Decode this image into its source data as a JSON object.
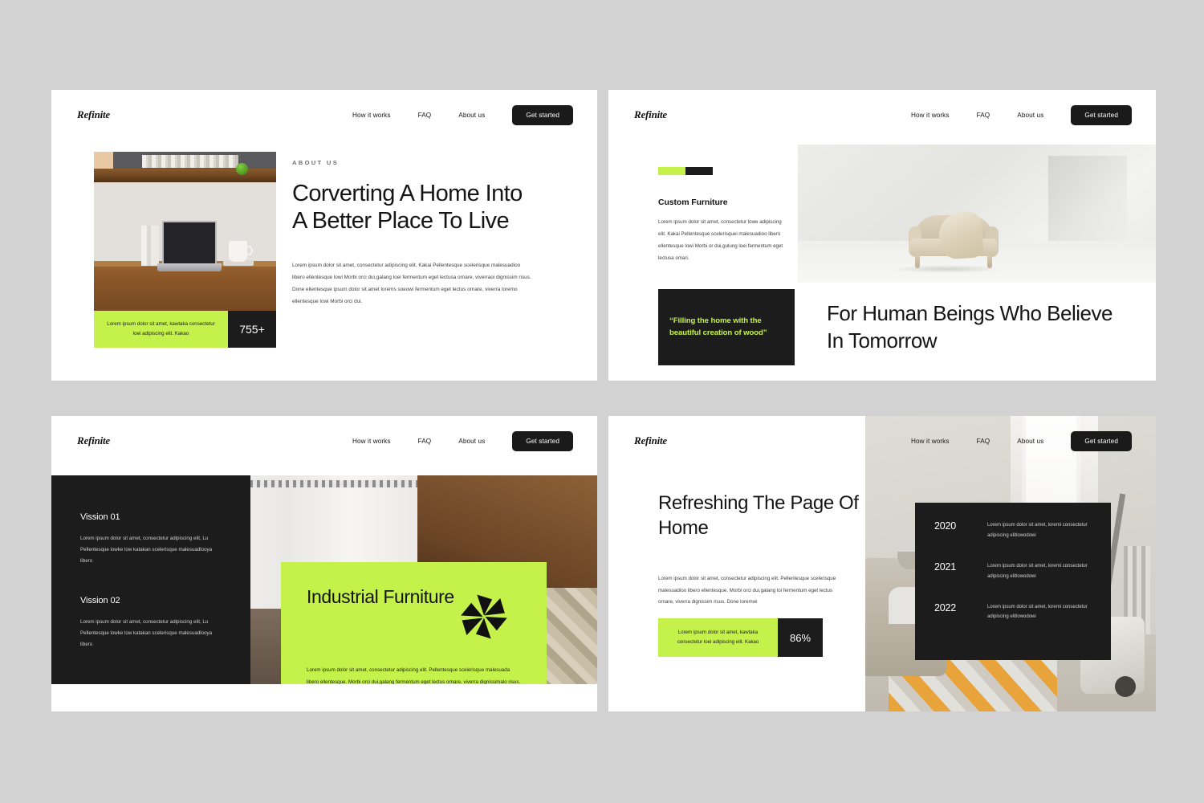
{
  "brand": {
    "logo": "Refinite",
    "accent_green": "#c4f24a",
    "dark": "#1c1c1c",
    "page_bg": "#d2d2d2"
  },
  "nav": {
    "links": [
      "How it works",
      "FAQ",
      "About us"
    ],
    "cta": "Get started"
  },
  "slide1": {
    "eyebrow": "ABOUT US",
    "heading": "Corverting A Home Into A Better Place To Live",
    "body": "Lorem ipsum dolor sit amet, consectetur adipiscing elit. Kakai Pellentesque scelerisque malesuadioo libero ellentesque lowi Morbi orci dui,galang loei fermentum eget lectusa ornare, viverraoi dignissim risus. Done ellentesque ipsum dolor sit amet lorems soeowi fermentum eget lectus ornare, viverra loremo ellentesque lowi Morbi orci dui.",
    "badge_text": "Lorem ipsum dolor sit amet, kawtaka consectetur loei adipiscing elit. Kakao",
    "badge_value": "755+",
    "photo_alt": "laptop-on-wooden-desk-photo"
  },
  "slide2": {
    "subheading": "Custom Furniture",
    "body": "Lorem ipsum dolor sit amet, consectetur lowe adipiscing elit. Kakai Pellentesque scelerisquei malesuadioo libero ellentesque lowi Morbi or dui,gulung loei fermentum eget lectusa omari.",
    "quote": "“Filling the home with the beautiful creation of wood”",
    "heading": "For Human Beings Who Believe In Tomorrow",
    "photo_alt": "cream-armchair-with-throw-photo"
  },
  "slide3": {
    "visions": [
      {
        "title": "Vission 01",
        "body": "Lorem ipsum dolor sit amet, consectetur adipiscing elit, Lu Pellentesque lowke low katakan scelerisque malesuadlooya libero"
      },
      {
        "title": "Vission 02",
        "body": "Lorem ipsum dolor sit amet, consectetur adipiscing elit, Lu Pellentesque lowke low katakan scelerisque malesuadlooya libero"
      }
    ],
    "card_heading": "Industrial Furniture",
    "card_body": "Lorem ipsum dolor sit amet, consectetur adipiscing elit. Pellentesque scelerisque malesuada libero ellentesque. Morbi orci dui,galang fermentum eget lectus ornare, viverra dignissimalo risus. Done ellentesque. Morbi orci duadlad adaadvefwiti,galang fermentum eget lectus",
    "icon": "pinwheel-icon",
    "photo_alt": "living-room-with-curtains-photo"
  },
  "slide4": {
    "heading": "Refreshing The Page Of Home",
    "body": "Lorem ipsum dolor sit amet, consectetur adipiscing elit. Pellentesque scelerisque malesuadioo libero ellentesque. Morbi orci dui,galang loi fermentum eget lectus ornare, viverra dignissim risus. Done loremwi",
    "badge_text": "Lorem ipsum dolor sit amet, kawtaka consectetur loei adipiscing elit. Kakao",
    "badge_value": "86%",
    "timeline": [
      {
        "year": "2020",
        "text": "Lorem ipsum dolor sit amet, loremi consectetur adipiscing elitlowodowi"
      },
      {
        "year": "2021",
        "text": "Lorem ipsum dolor sit amet, loremi consectetur adipiscing elitlowodowi"
      },
      {
        "year": "2022",
        "text": "Lorem ipsum dolor sit amet, loremi consectetur adipiscing elitlowodowi"
      }
    ],
    "photo_alt": "man-and-child-in-living-room-photo"
  }
}
